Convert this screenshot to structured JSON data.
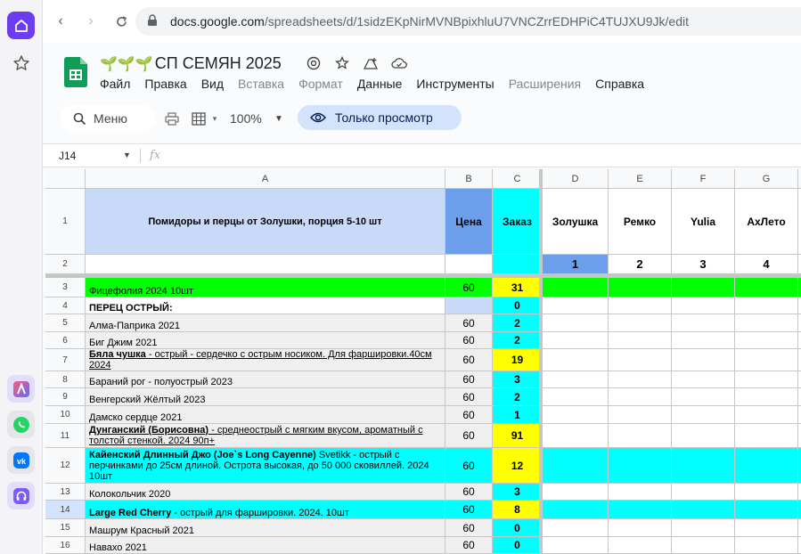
{
  "browser": {
    "url_host": "docs.google.com",
    "url_path": "/spreadsheets/d/1sidzEKpNirMVNBpixhluU7VNCZrrEDHPiC4TUJXU9Jk/edit"
  },
  "doc": {
    "title": "СП СЕМЯН 2025",
    "title_prefix": "🌱🌱🌱",
    "menu": [
      {
        "label": "Файл",
        "enabled": true
      },
      {
        "label": "Правка",
        "enabled": true
      },
      {
        "label": "Вид",
        "enabled": true
      },
      {
        "label": "Вставка",
        "enabled": false
      },
      {
        "label": "Формат",
        "enabled": false
      },
      {
        "label": "Данные",
        "enabled": true
      },
      {
        "label": "Инструменты",
        "enabled": true
      },
      {
        "label": "Расширения",
        "enabled": false
      },
      {
        "label": "Справка",
        "enabled": true
      }
    ]
  },
  "toolbar": {
    "search_label": "Меню",
    "zoom": "100%",
    "view_only_label": "Только просмотр"
  },
  "formula_bar": {
    "cell_ref": "J14",
    "fx": "fx"
  },
  "colors": {
    "header_blue": "#c9daf8",
    "price_blue": "#6d9eeb",
    "cyan": "#00ffff",
    "yellow": "#ffff00",
    "green": "#00ff00",
    "participant_blue": "#6d9eeb",
    "row_grey": "#efefef"
  },
  "grid": {
    "columns": [
      "A",
      "B",
      "C",
      "D",
      "E",
      "F",
      "G"
    ],
    "header_row": {
      "a": "Помидоры и перцы от Золушки, порция 5-10 шт",
      "b": "Цена",
      "c": "Заказ",
      "d": "Золушка",
      "e": "Ремко",
      "f": "Yulia",
      "g": "АхЛето"
    },
    "row2": {
      "d": "1",
      "e": "2",
      "f": "3",
      "g": "4"
    },
    "rows": [
      {
        "n": "3",
        "name": "Фицефолия 2024 10шт",
        "price": "60",
        "order": "31"
      },
      {
        "n": "4",
        "name": "ПЕРЕЦ ОСТРЫЙ:",
        "price": "",
        "order": "0"
      },
      {
        "n": "5",
        "name": "Алма-Паприка 2021",
        "price": "60",
        "order": "2"
      },
      {
        "n": "6",
        "name": "Биг Джим 2021",
        "price": "60",
        "order": "2"
      },
      {
        "n": "7",
        "name_bold": "Бяла чушка",
        "name": " - острый  - сердечко с острым носиком. Для фаршировки.40см  2024",
        "price": "60",
        "order": "19"
      },
      {
        "n": "8",
        "name": "Бараний рог - полуострый 2023",
        "price": "60",
        "order": "3"
      },
      {
        "n": "9",
        "name": "Венгерский Жёлтый 2023",
        "price": "60",
        "order": "2"
      },
      {
        "n": "10",
        "name": "Дамско сердце 2021",
        "price": "60",
        "order": "1"
      },
      {
        "n": "11",
        "name_bold": "Дунганский (Борисовна)",
        "name": "  - среднеострый с мягким вкусом, ароматный с толстой стенкой. 2024 90п+",
        "price": "60",
        "order": "91"
      },
      {
        "n": "12",
        "name_bold": "Кайенский Длинный Джо (Joe`s Long Cayenne)",
        "name": " Svetikk - острый с перчинками до 25см длиной. Острота высокая, до 50 000 сковиллей. 2024 10шт",
        "price": "60",
        "order": "12"
      },
      {
        "n": "13",
        "name": "Колокольчик 2020",
        "price": "60",
        "order": "3"
      },
      {
        "n": "14",
        "name_bold": "Large Red Cherry",
        "name": " - острый для фаршировки. 2024. 10шт",
        "price": "60",
        "order": "8"
      },
      {
        "n": "15",
        "name": "Машрум Красный 2021",
        "price": "60",
        "order": "0"
      },
      {
        "n": "16",
        "name": "Навахо 2021",
        "price": "60",
        "order": "0"
      }
    ]
  }
}
